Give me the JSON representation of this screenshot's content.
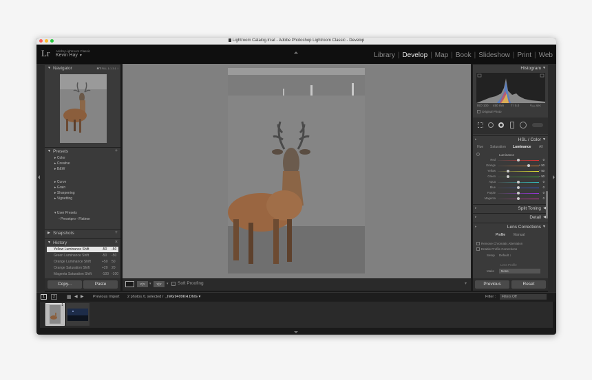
{
  "window": {
    "title": "Lightroom Catalog.lrcat - Adobe Photoshop Lightroom Classic - Develop",
    "traffic_colors": [
      "#fd5f57",
      "#fdbb2d",
      "#28c840"
    ]
  },
  "identity": {
    "logo": "Lr",
    "app_name": "Adobe Lightroom Classic",
    "user": "Kevin Hay"
  },
  "modules": [
    "Library",
    "Develop",
    "Map",
    "Book",
    "Slideshow",
    "Print",
    "Web"
  ],
  "active_module": "Develop",
  "left": {
    "navigator": {
      "label": "Navigator",
      "zoom_options": [
        "FIT",
        "FILL",
        "1:1",
        "3:1"
      ],
      "zoom_extra": "↕"
    },
    "presets": {
      "label": "Presets",
      "groups1": [
        "Color",
        "Creative",
        "B&W"
      ],
      "groups2": [
        "Curve",
        "Grain",
        "Sharpening",
        "Vignetting"
      ],
      "user_group": "User Presets",
      "user_item": "Presetpro - Flatiron"
    },
    "snapshots": {
      "label": "Snapshots"
    },
    "history": {
      "label": "History",
      "items": [
        {
          "name": "Yellow Luminance Shift",
          "a": "-50",
          "b": "-50"
        },
        {
          "name": "Green Luminance Shift",
          "a": "-50",
          "b": "-50"
        },
        {
          "name": "Orange Luminance Shift",
          "a": "+50",
          "b": "50"
        },
        {
          "name": "Orange Saturation Shift",
          "a": "+20",
          "b": "20"
        },
        {
          "name": "Magenta Saturation Shift",
          "a": "-100",
          "b": "-100"
        }
      ]
    },
    "copy_label": "Copy...",
    "paste_label": "Paste"
  },
  "toolbar": {
    "soft_proofing": "Soft Proofing",
    "view_a": "Y|Y",
    "view_b": "Y|Y"
  },
  "right": {
    "histogram": {
      "label": "Histogram",
      "iso": "ISO 100",
      "focal": "450 mm",
      "aperture": "f / 5.0",
      "shutter": "¹⁄₂₅₀ sec",
      "original_photo": "Original Photo"
    },
    "hsl": {
      "label": "HSL / Color",
      "tabs": [
        "Hue",
        "Saturation",
        "Luminance",
        "All"
      ],
      "active_tab": "Luminance",
      "section": "Luminance",
      "rows": [
        {
          "name": "Red",
          "value": "0",
          "pos": 0.5,
          "color": "#d33"
        },
        {
          "name": "Orange",
          "value": "+ 50",
          "pos": 0.75,
          "color": "#e83"
        },
        {
          "name": "Yellow",
          "value": "− 50",
          "pos": 0.25,
          "color": "#dd3"
        },
        {
          "name": "Green",
          "value": "− 50",
          "pos": 0.25,
          "color": "#3b3"
        },
        {
          "name": "Aqua",
          "value": "0",
          "pos": 0.5,
          "color": "#3bb"
        },
        {
          "name": "Blue",
          "value": "0",
          "pos": 0.5,
          "color": "#35d"
        },
        {
          "name": "Purple",
          "value": "0",
          "pos": 0.5,
          "color": "#93d"
        },
        {
          "name": "Magenta",
          "value": "0",
          "pos": 0.5,
          "color": "#d3a"
        }
      ]
    },
    "split_toning": "Split Toning",
    "detail": "Detail",
    "lens": {
      "label": "Lens Corrections",
      "tabs": [
        "Profile",
        "Manual"
      ],
      "remove_ca": "Remove Chromatic Aberration",
      "enable_profile": "Enable Profile Corrections",
      "setup_label": "Setup",
      "setup_value": "Default ↕",
      "lens_profile": "Lens Profile",
      "make_label": "Make",
      "make_value": "None"
    },
    "previous_label": "Previous",
    "reset_label": "Reset"
  },
  "filmbar": {
    "screen1": "1",
    "screen2": "2",
    "source": "Previous Import",
    "info": "2 photos /1 selected /",
    "filename": "_IMG9409KH.DNG",
    "filter_label": "Filter :",
    "filter_value": "Filters Off"
  },
  "filmstrip": {
    "thumb_index": "1"
  }
}
